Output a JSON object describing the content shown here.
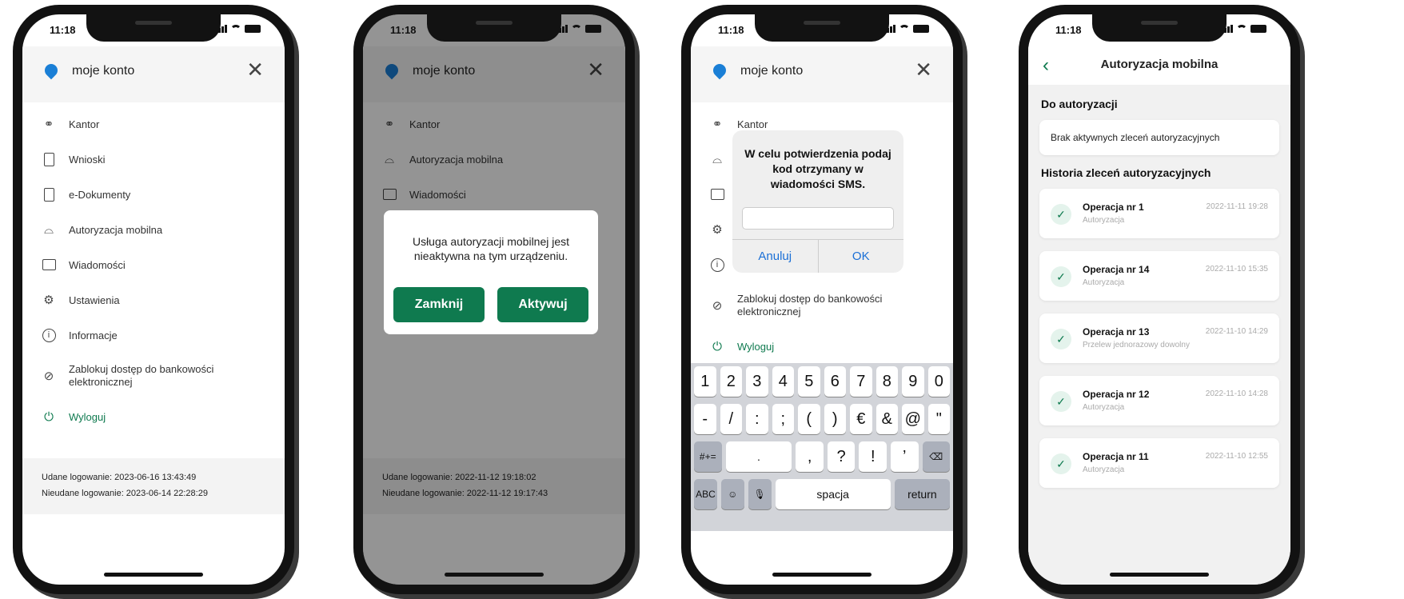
{
  "status_time": "11:18",
  "colors": {
    "brand_green": "#0f7a4f",
    "ios_blue": "#1a6fd6"
  },
  "phone1": {
    "header_title": "moje konto",
    "menu": [
      {
        "icon": "kantor-icon",
        "label": "Kantor"
      },
      {
        "icon": "document-icon",
        "label": "Wnioski"
      },
      {
        "icon": "e-document-icon",
        "label": "e-Dokumenty"
      },
      {
        "icon": "mobile-auth-icon",
        "label": "Autoryzacja mobilna"
      },
      {
        "icon": "chat-icon",
        "label": "Wiadomości"
      },
      {
        "icon": "gear-icon",
        "label": "Ustawienia"
      },
      {
        "icon": "info-icon",
        "label": "Informacje"
      },
      {
        "icon": "block-icon",
        "label": "Zablokuj dostęp do bankowości elektronicznej"
      },
      {
        "icon": "power-icon",
        "label": "Wyloguj"
      }
    ],
    "login_ok": "Udane logowanie: 2023-06-16 13:43:49",
    "login_fail": "Nieudane logowanie: 2023-06-14 22:28:29"
  },
  "phone2": {
    "header_title": "moje konto",
    "menu": [
      "Kantor",
      "Autoryzacja mobilna",
      "Wiadomości"
    ],
    "dialog_message": "Usługa autoryzacji mobilnej jest nieaktywna na tym urządzeniu.",
    "btn_close": "Zamknij",
    "btn_activate": "Aktywuj",
    "login_ok": "Udane logowanie: 2022-11-12 19:18:02",
    "login_fail": "Nieudane logowanie: 2022-11-12 19:17:43"
  },
  "phone3": {
    "header_title": "moje konto",
    "menu_kantor": "Kantor",
    "menu_block": "Zablokuj dostęp do bankowości elektronicznej",
    "menu_logout": "Wyloguj",
    "alert_message": "W celu potwierdzenia podaj kod otrzymany w wiadomości SMS.",
    "alert_cancel": "Anuluj",
    "alert_ok": "OK",
    "keyboard": {
      "row1": [
        "1",
        "2",
        "3",
        "4",
        "5",
        "6",
        "7",
        "8",
        "9",
        "0"
      ],
      "row2": [
        "-",
        "/",
        ":",
        ";",
        "(",
        ")",
        "€",
        "&",
        "@",
        "\""
      ],
      "row3_left": "#+=",
      "row3": [
        ".",
        ",",
        "?",
        "!",
        "’"
      ],
      "abc": "ABC",
      "space": "spacja",
      "return": "return"
    }
  },
  "phone4": {
    "title": "Autoryzacja mobilna",
    "section_pending": "Do autoryzacji",
    "empty_pending": "Brak aktywnych zleceń autoryzacyjnych",
    "section_history": "Historia zleceń autoryzacyjnych",
    "operations": [
      {
        "name": "Operacja nr 1",
        "type": "Autoryzacja",
        "date": "2022-11-11 19:28"
      },
      {
        "name": "Operacja nr 14",
        "type": "Autoryzacja",
        "date": "2022-11-10 15:35"
      },
      {
        "name": "Operacja nr 13",
        "type": "Przelew jednorazowy dowolny",
        "date": "2022-11-10 14:29"
      },
      {
        "name": "Operacja nr 12",
        "type": "Autoryzacja",
        "date": "2022-11-10 14:28"
      },
      {
        "name": "Operacja nr 11",
        "type": "Autoryzacja",
        "date": "2022-11-10 12:55"
      }
    ]
  }
}
